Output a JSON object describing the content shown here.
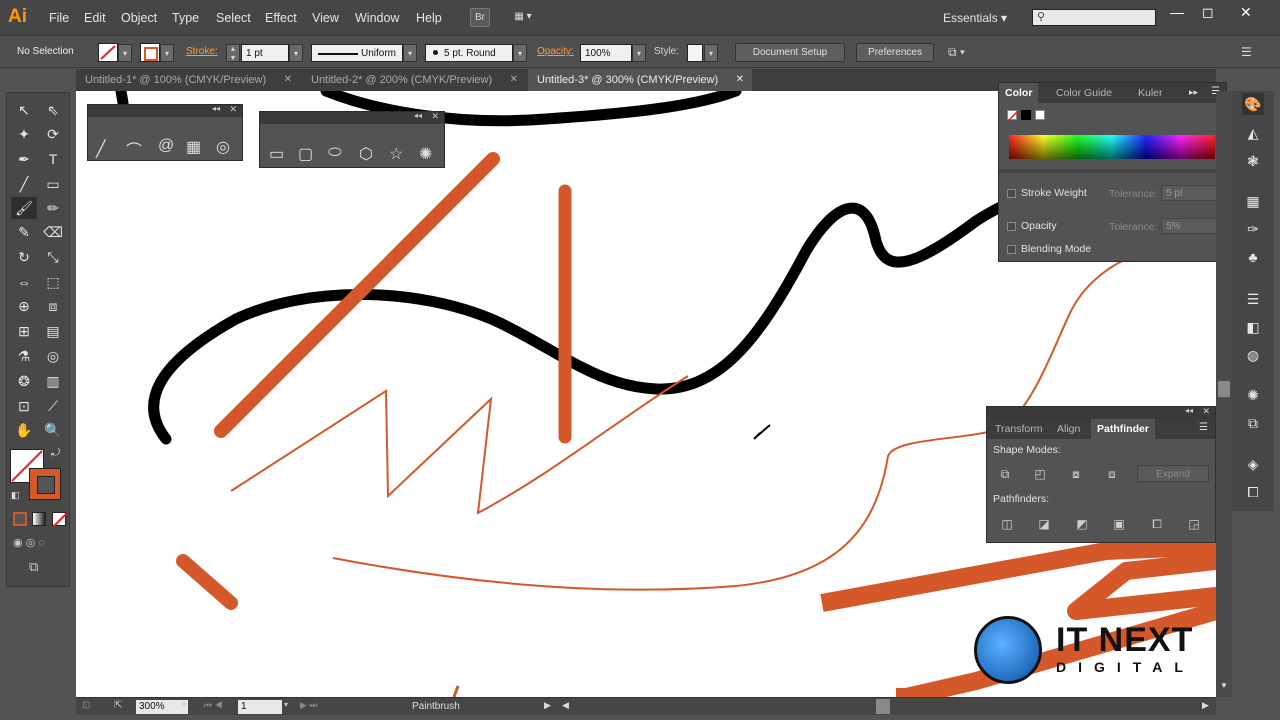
{
  "app": {
    "logo": "Ai"
  },
  "menu": [
    "File",
    "Edit",
    "Object",
    "Type",
    "Select",
    "Effect",
    "View",
    "Window",
    "Help"
  ],
  "menubar_buttons": {
    "bridge": "Br",
    "arrange": "▦ ▾"
  },
  "workspace": {
    "label": "Essentials",
    "search_placeholder": ""
  },
  "window_controls": {
    "minimize": "—",
    "maximize": "◻",
    "close": "✕"
  },
  "control_bar": {
    "selection": "No Selection",
    "stroke_label": "Stroke:",
    "stroke_weight": "1 pt",
    "profile": "Uniform",
    "brush": "5 pt. Round",
    "opacity_label": "Opacity:",
    "opacity_value": "100%",
    "style_label": "Style:",
    "document_setup": "Document Setup",
    "preferences": "Preferences"
  },
  "tabs": [
    {
      "label": "Untitled-1* @ 100% (CMYK/Preview)",
      "active": false
    },
    {
      "label": "Untitled-2* @ 200% (CMYK/Preview)",
      "active": false
    },
    {
      "label": "Untitled-3* @ 300% (CMYK/Preview)",
      "active": true
    }
  ],
  "tab_close": "✕",
  "color_panel": {
    "tabs": [
      "Color",
      "Color Guide",
      "Kuler"
    ],
    "options": [
      {
        "label": "Stroke Weight",
        "tolerance_label": "Tolerance:",
        "tolerance_value": "5 pt"
      },
      {
        "label": "Opacity",
        "tolerance_label": "Tolerance:",
        "tolerance_value": "5%"
      },
      {
        "label": "Blending Mode"
      }
    ]
  },
  "pathfinder_panel": {
    "tabs": [
      "Transform",
      "Align",
      "Pathfinder"
    ],
    "shape_modes_label": "Shape Modes:",
    "expand": "Expand",
    "pathfinders_label": "Pathfinders:"
  },
  "status_bar": {
    "zoom": "300%",
    "page": "1",
    "tool": "Paintbrush"
  },
  "watermark": {
    "line1": "IT NEXT",
    "line2": "DIGITAL"
  },
  "colors": {
    "accent_orange": "#d5582a",
    "stroke_black": "#000000",
    "ai_orange": "#ff9a00"
  }
}
